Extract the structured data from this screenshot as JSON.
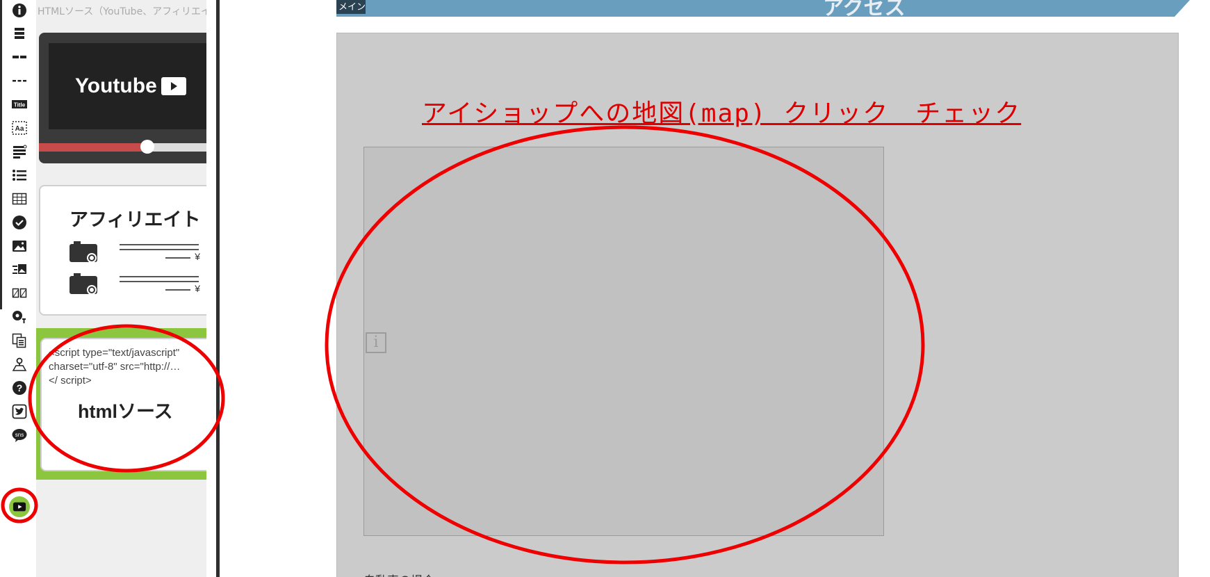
{
  "rail": {
    "items": [
      {
        "icon": "info-icon"
      },
      {
        "icon": "heading-bar-icon"
      },
      {
        "icon": "dashed-divider-icon"
      },
      {
        "icon": "dotted-divider-icon"
      },
      {
        "icon": "title-badge-icon",
        "text": "Title"
      },
      {
        "icon": "text-box-icon",
        "text": "Aa"
      },
      {
        "icon": "paragraph-icon"
      },
      {
        "icon": "list-icon"
      },
      {
        "icon": "table-icon"
      },
      {
        "icon": "check-circle-icon"
      },
      {
        "icon": "image-icon"
      },
      {
        "icon": "image-text-icon"
      },
      {
        "icon": "two-column-icon"
      },
      {
        "icon": "voice-icon"
      },
      {
        "icon": "copy-pages-icon"
      },
      {
        "icon": "map-pin-icon"
      },
      {
        "icon": "question-icon"
      },
      {
        "icon": "twitter-icon"
      },
      {
        "icon": "sns-icon",
        "text": "sns"
      },
      {
        "icon": "youtube-play-icon",
        "active": true
      }
    ]
  },
  "panel": {
    "title": "HTMLソース（YouTube、アフィリエイ…",
    "youtube_card": {
      "logo_text": "Youtube",
      "progress": 0.6
    },
    "affiliate_card": {
      "title": "アフィリエイト",
      "price_mark": "¥"
    },
    "html_card": {
      "code_lines": [
        "<script type=\"text/javascript\"",
        "charset=\"utf-8\" src=\"http://…",
        "</ script>"
      ],
      "label": "htmlソース"
    }
  },
  "main": {
    "tag": "メイン",
    "header_title": "アクセス",
    "map_link": "アイショップへの地図(map) クリック　チェック",
    "map_info_glyph": "i",
    "note": "自動車の場合"
  },
  "colors": {
    "accent_green": "#8cc63f",
    "header_blue": "#6a9ebf",
    "annotation_red": "#ee0000",
    "link_red": "#dd0000"
  }
}
